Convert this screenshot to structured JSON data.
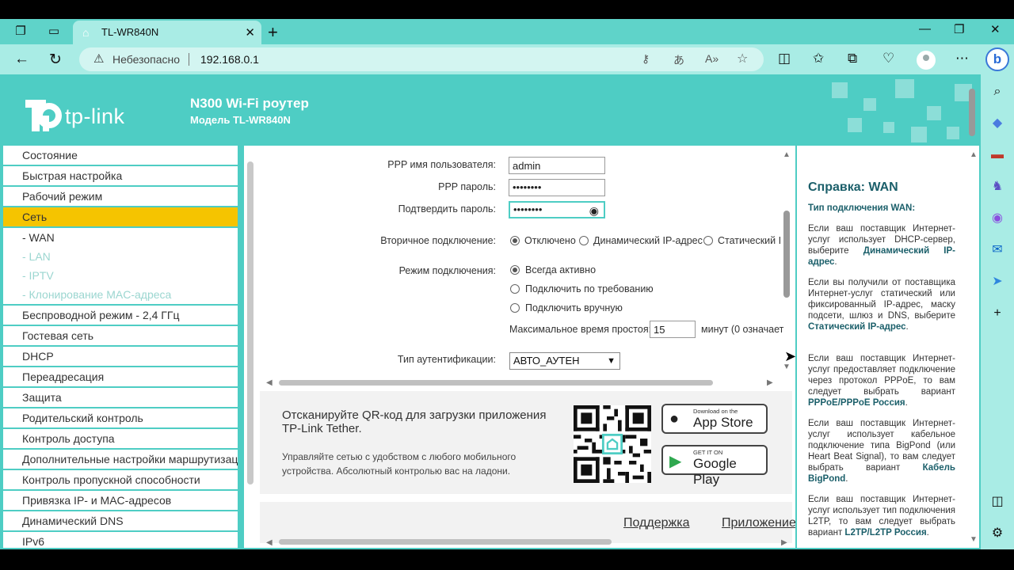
{
  "browser": {
    "tab_title": "TL-WR840N",
    "insecure_label": "Небезопасно",
    "url": "192.168.0.1",
    "new_tab": "+",
    "close": "✕"
  },
  "header": {
    "logo_text": "tp-link",
    "product_title": "N300 Wi-Fi роутер",
    "product_model": "Модель TL-WR840N"
  },
  "menu": {
    "items_before": [
      "Состояние",
      "Быстрая настройка",
      "Рабочий режим"
    ],
    "active": "Сеть",
    "subitems": [
      "- WAN",
      "- LAN",
      "- IPTV",
      "- Клонирование MAC-адреса"
    ],
    "items_after": [
      "Беспроводной режим - 2,4 ГГц",
      "Гостевая сеть",
      "DHCP",
      "Переадресация",
      "Защита",
      "Родительский контроль",
      "Контроль доступа",
      "Дополнительные настройки маршрутизации",
      "Контроль пропускной способности",
      "Привязка IP- и MAC-адресов",
      "Динамический DNS",
      "IPv6"
    ]
  },
  "form": {
    "ppp_user_label": "PPP имя пользователя:",
    "ppp_user_value": "admin",
    "ppp_pass_label": "PPP пароль:",
    "ppp_pass_value": "••••••••",
    "confirm_label": "Подтвердить пароль:",
    "confirm_value": "••••••••",
    "secondary_label": "Вторичное подключение:",
    "secondary_options": [
      "Отключено",
      "Динамический IP-адрес",
      "Статический I"
    ],
    "mode_label": "Режим подключения:",
    "mode_options": [
      "Всегда активно",
      "Подключить по требованию",
      "Подключить вручную"
    ],
    "idle_label": "Максимальное время простоя:",
    "idle_value": "15",
    "idle_suffix": "минут (0 означает",
    "auth_label": "Тип аутентификации:",
    "auth_value": "АВТО_АУТЕН"
  },
  "promo": {
    "title": "Отсканируйте QR-код для загрузки приложения TP-Link Tether.",
    "text": "Управляйте сетью с удобством с любого мобильного устройства. Абсолютный контролью вас на ладони.",
    "appstore_small": "Download on the",
    "appstore_big": "App Store",
    "gplay_small": "GET IT ON",
    "gplay_big": "Google Play"
  },
  "footer": {
    "support": "Поддержка",
    "app": "Приложение"
  },
  "help": {
    "title": "Справка: WAN",
    "subtitle": "Тип подключения WAN:",
    "p1": "Если ваш поставщик Интернет-услуг использует DHCP-сервер, выберите",
    "p1b": "Динамический IP-адрес",
    "p2": "Если вы получили от поставщика Интернет-услуг статический или фиксированный IP-адрес, маску подсети, шлюз и DNS, выберите",
    "p2b": "Статический IP-адрес",
    "p3": "Если ваш поставщик Интернет-услуг предоставляет подключение через протокол PPPoE, то вам следует выбрать вариант",
    "p3b": "PPPoE/PPPoE Россия",
    "p4": "Если ваш поставщик Интернет-услуг использует кабельное подключение типа BigPond (или Heart Beat Signal), то вам следует выбрать вариант",
    "p4b": "Кабель BigPond",
    "p5": "Если ваш поставщик Интернет-услуг использует тип подключения L2TP, то вам следует выбрать вариант",
    "p5b": "L2TP/L2TP Россия"
  },
  "colors": {
    "tabstrip": "#5fd3c9",
    "addressbar": "#a9ece5",
    "page_bg": "#4ecdc4",
    "active_menu": "#f5c400",
    "help_accent": "#1b5f6a"
  }
}
